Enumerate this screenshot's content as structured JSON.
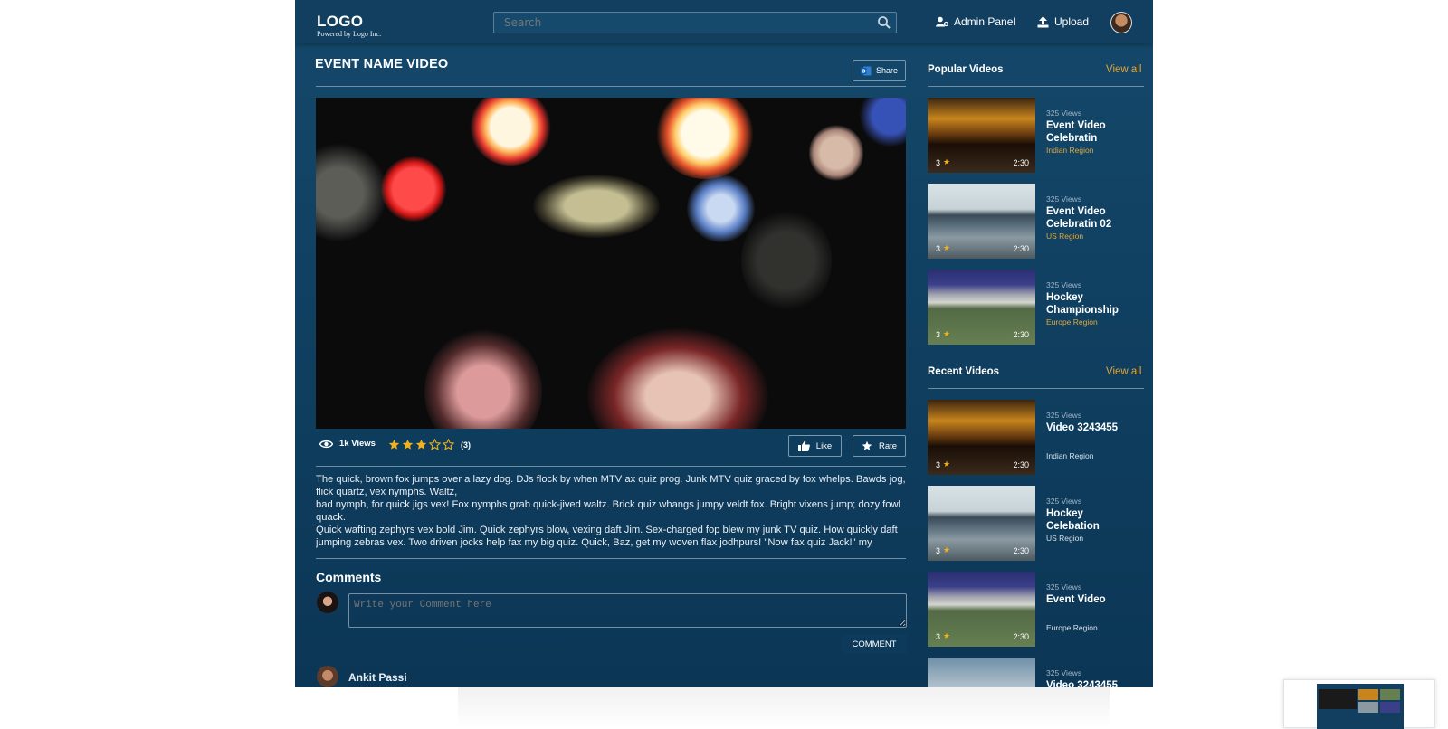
{
  "header": {
    "logo": "LOGO",
    "logo_sub": "Powered by Logo Inc.",
    "search_placeholder": "Search",
    "admin_label": "Admin Panel",
    "upload_label": "Upload"
  },
  "video": {
    "title": "EVENT NAME VIDEO",
    "share_label": "Share",
    "views": "1k Views",
    "rating": 3,
    "rating_max": 5,
    "rating_count": "(3)",
    "like_label": "Like",
    "rate_label": "Rate",
    "description": [
      "The quick, brown fox jumps over a lazy dog. DJs flock by when MTV ax quiz prog. Junk MTV quiz graced by fox whelps. Bawds jog, flick quartz, vex nymphs. Waltz,",
      "bad nymph, for quick jigs vex! Fox nymphs grab quick-jived waltz. Brick quiz whangs jumpy veldt fox. Bright vixens jump; dozy fowl quack.",
      "Quick wafting zephyrs vex bold Jim. Quick zephyrs blow, vexing daft Jim. Sex-charged fop blew my junk TV quiz. How quickly daft jumping zebras vex. Two driven jocks help fax my big quiz. Quick, Baz, get my woven flax jodhpurs! \"Now fax quiz Jack!\" my"
    ]
  },
  "comments": {
    "heading": "Comments",
    "placeholder": "Write your Comment here",
    "button_label": "COMMENT",
    "first_commenter": "Ankit Passi"
  },
  "popular": {
    "heading": "Popular Videos",
    "view_all": "View all",
    "items": [
      {
        "views": "325 Views",
        "title": "Event Video Celebratin",
        "region": "Indian Region",
        "rating": "3",
        "duration": "2:30"
      },
      {
        "views": "325 Views",
        "title": "Event Video Celebratin 02",
        "region": "US Region",
        "rating": "3",
        "duration": "2:30"
      },
      {
        "views": "325 Views",
        "title": "Hockey Championship",
        "region": "Europe Region",
        "rating": "3",
        "duration": "2:30"
      }
    ]
  },
  "recent": {
    "heading": "Recent Videos",
    "view_all": "View all",
    "items": [
      {
        "views": "325 Views",
        "title": "Video 3243455",
        "region": "Indian Region",
        "rating": "3",
        "duration": "2:30"
      },
      {
        "views": "325 Views",
        "title": "Hockey Celebation",
        "region": "US Region",
        "rating": "3",
        "duration": "2:30"
      },
      {
        "views": "325 Views",
        "title": "Event Video",
        "region": "Europe Region",
        "rating": "3",
        "duration": "2:30"
      },
      {
        "views": "325 Views",
        "title": "Video 3243455",
        "region": "",
        "rating": "",
        "duration": ""
      }
    ]
  },
  "colors": {
    "accent": "#e2a73a",
    "bg": "#0f3e5f",
    "star": "#f2b21b"
  }
}
